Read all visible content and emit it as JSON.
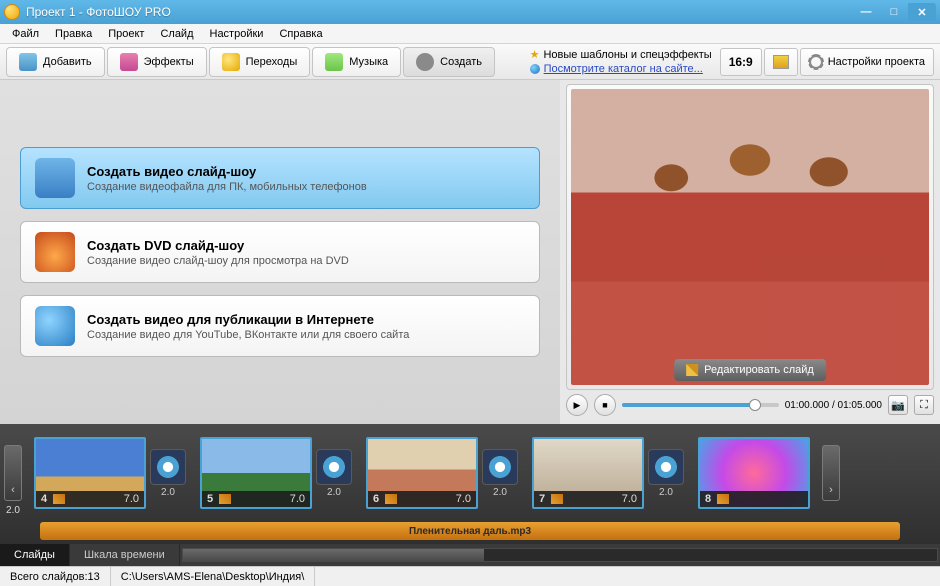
{
  "window": {
    "title": "Проект 1 - ФотоШОУ PRO"
  },
  "menu": [
    "Файл",
    "Правка",
    "Проект",
    "Слайд",
    "Настройки",
    "Справка"
  ],
  "tabs": {
    "add": "Добавить",
    "fx": "Эффекты",
    "trans": "Переходы",
    "music": "Музыка",
    "create": "Создать"
  },
  "info": {
    "line1": "Новые шаблоны и спецэффекты",
    "line2": "Посмотрите каталог на сайте..."
  },
  "aspect": "16:9",
  "settings": "Настройки проекта",
  "options": [
    {
      "title": "Создать видео слайд-шоу",
      "desc": "Создание видеофайла для ПК, мобильных телефонов"
    },
    {
      "title": "Создать DVD слайд-шоу",
      "desc": "Создание видео слайд-шоу для просмотра на DVD"
    },
    {
      "title": "Создать видео для публикации в Интернете",
      "desc": "Создание видео для YouTube, ВКонтакте или для своего сайта"
    }
  ],
  "preview": {
    "edit": "Редактировать слайд",
    "time": "01:00.000 / 01:05.000"
  },
  "timeline": {
    "left_arrow": "‹",
    "left_num": "2.0",
    "right_arrow": "›",
    "clips": [
      {
        "num": "4",
        "dur": "7.0",
        "trans": "2.0"
      },
      {
        "num": "5",
        "dur": "7.0",
        "trans": "2.0"
      },
      {
        "num": "6",
        "dur": "7.0",
        "trans": "2.0"
      },
      {
        "num": "7",
        "dur": "7.0",
        "trans": "2.0"
      },
      {
        "num": "8",
        "dur": ""
      }
    ],
    "audio": "Пленительная даль.mp3",
    "tab_slides": "Слайды",
    "tab_timeline": "Шкала времени"
  },
  "status": {
    "count_label": "Всего слайдов: ",
    "count": "13",
    "path": "C:\\Users\\AMS-Elena\\Desktop\\Индия\\"
  }
}
